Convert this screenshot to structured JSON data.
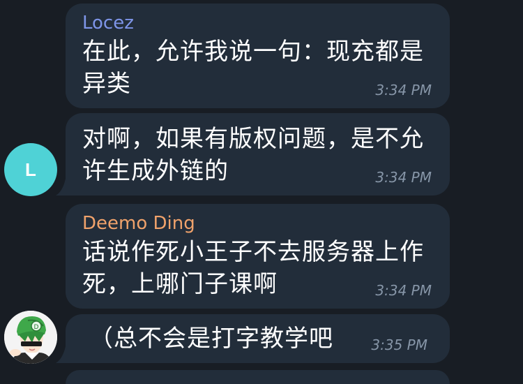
{
  "messages": [
    {
      "sender": "Locez",
      "sender_color": "#7e95e8",
      "text": "在此，允许我说一句：现充都是异类",
      "time": "3:34 PM"
    },
    {
      "sender": "",
      "text": "对啊，如果有版权问题，是不允许生成外链的",
      "time": "3:34 PM",
      "avatar_letter": "L",
      "avatar_color": "#4fd2d6"
    },
    {
      "sender": "Deemo Ding",
      "sender_color": "#f0a26b",
      "text": "话说作死小王子不去服务器上作死，上哪门子课啊",
      "time": "3:34 PM"
    },
    {
      "sender": "",
      "text": "（总不会是打字教学吧",
      "time": "3:35 PM"
    }
  ]
}
